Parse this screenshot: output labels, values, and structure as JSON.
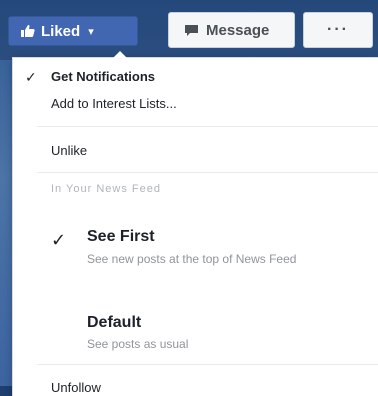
{
  "colors": {
    "page_bg": "#3b5998",
    "liked_button": "#4267b2",
    "menu_bg": "#ffffff",
    "muted_text": "#90949c"
  },
  "toolbar": {
    "liked_label": "Liked",
    "liked_icon": "thumbs-up-icon",
    "chevron": "▾",
    "message_label": "Message",
    "message_icon": "message-icon",
    "more_label": "···"
  },
  "menu": {
    "get_notifications": "Get Notifications",
    "add_to_interest_lists": "Add to Interest Lists...",
    "unlike": "Unlike",
    "section_label": "In Your News Feed",
    "see_first": {
      "title": "See First",
      "description": "See new posts at the top of News Feed",
      "selected": true
    },
    "default": {
      "title": "Default",
      "description": "See posts as usual"
    },
    "unfollow": "Unfollow",
    "checkmark": "✓"
  }
}
